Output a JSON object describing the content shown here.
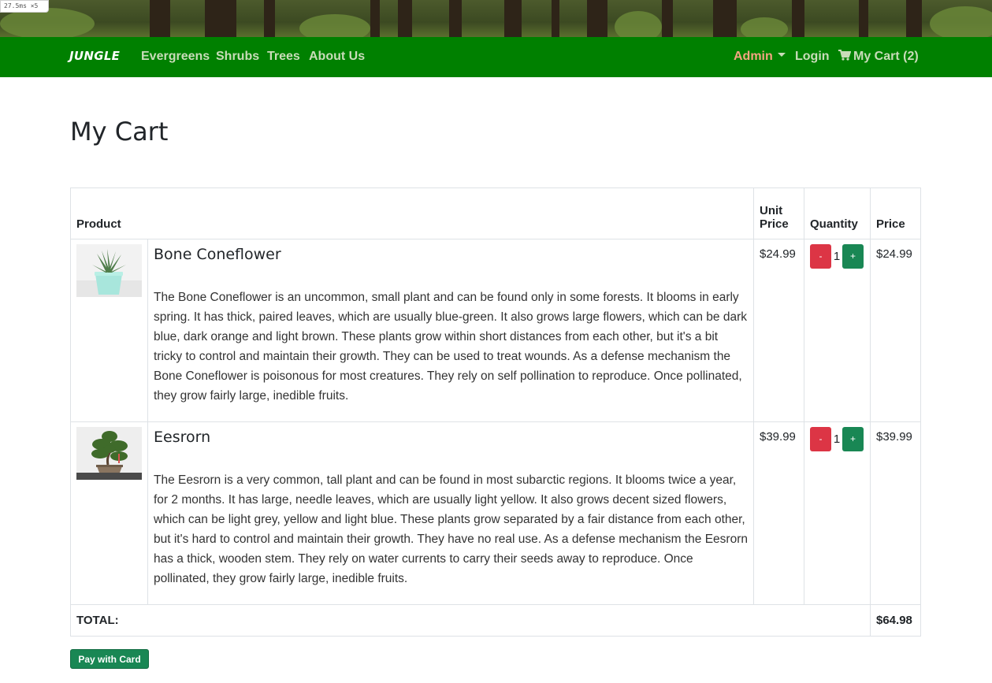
{
  "perf_badge": "27.5ms ×5",
  "nav": {
    "brand": "JUNGLE",
    "links": [
      "Evergreens",
      "Shrubs",
      "Trees",
      "About Us"
    ],
    "admin_label": "Admin",
    "login_label": "Login",
    "cart_label": "My Cart (2)"
  },
  "page": {
    "title": "My Cart"
  },
  "table": {
    "headers": {
      "product": "Product",
      "unit_price": "Unit Price",
      "quantity": "Quantity",
      "price": "Price"
    },
    "rows": [
      {
        "name": "Bone Coneflower",
        "description": "The Bone Coneflower is an uncommon, small plant and can be found only in some forests. It blooms in early spring. It has thick, paired leaves, which are usually blue-green. It also grows large flowers, which can be dark blue, dark orange and light brown. These plants grow within short distances from each other, but it's a bit tricky to control and maintain their growth. They can be used to treat wounds. As a defense mechanism the Bone Coneflower is poisonous for most creatures. They rely on self pollination to reproduce. Once pollinated, they grow fairly large, inedible fruits.",
        "unit_price": "$24.99",
        "quantity": "1",
        "price": "$24.99",
        "minus": "-",
        "plus": "+"
      },
      {
        "name": "Eesrorn",
        "description": "The Eesrorn is a very common, tall plant and can be found in most subarctic regions. It blooms twice a year, for 2 months. It has large, needle leaves, which are usually light yellow. It also grows decent sized flowers, which can be light grey, yellow and light blue. These plants grow separated by a fair distance from each other, but it's hard to control and maintain their growth. They have no real use. As a defense mechanism the Eesrorn has a thick, wooden stem. They rely on water currents to carry their seeds away to reproduce. Once pollinated, they grow fairly large, inedible fruits.",
        "unit_price": "$39.99",
        "quantity": "1",
        "price": "$39.99",
        "minus": "-",
        "plus": "+"
      }
    ],
    "total_label": "TOTAL:",
    "total_value": "$64.98"
  },
  "pay_button": "Pay with Card",
  "colors": {
    "navbar": "#008000",
    "admin": "#f4a582",
    "minus_btn": "#dc3545",
    "plus_btn": "#198754"
  },
  "icons": {
    "cart": "shopping-cart-icon",
    "admin_caret": "chevron-down-icon"
  }
}
